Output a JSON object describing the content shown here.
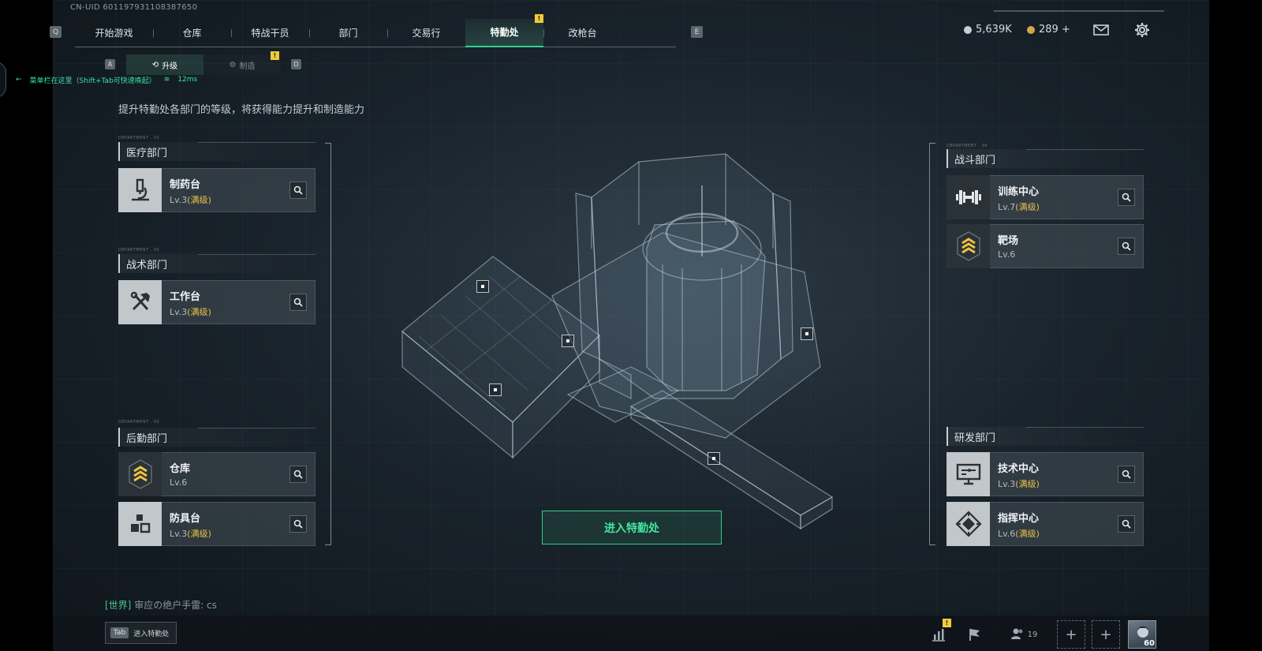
{
  "uid": "CN-UID 601197931108387650",
  "nav": {
    "key_left": "Q",
    "key_right": "E",
    "tabs": [
      "开始游戏",
      "仓库",
      "特战干员",
      "部门",
      "交易行",
      "特勤处",
      "改枪台"
    ],
    "active": "特勤处",
    "alert": "!"
  },
  "resources": {
    "silver": "5,639K",
    "gold": "289 +",
    "silver_color": "#c7cdd2",
    "gold_color": "#d4a64a",
    "mail_icon": "mail-icon",
    "settings_icon": "gear-icon"
  },
  "subnav": {
    "key_left": "A",
    "key_right": "D",
    "upgrade": "升级",
    "craft": "制造",
    "alert": "!"
  },
  "hint": {
    "text": "菜单栏在这里（Shift+Tab可快速唤起）",
    "ping": "12ms"
  },
  "description": "提升特勤处各部门的等级，将获得能力提升和制造能力",
  "departments": {
    "medical": {
      "title": "医疗部门",
      "tag": "DEPARTMENT . 01",
      "items": [
        {
          "name": "制药台",
          "level": "Lv.3",
          "max": "(满级)",
          "icon": "microscope-icon"
        }
      ]
    },
    "tactical": {
      "title": "战术部门",
      "tag": "DEPARTMENT . 02",
      "items": [
        {
          "name": "工作台",
          "level": "Lv.3",
          "max": "(满级)",
          "icon": "hammer-wrench-icon"
        }
      ]
    },
    "logistics": {
      "title": "后勤部门",
      "tag": "DEPARTMENT . 03",
      "items": [
        {
          "name": "仓库",
          "level": "Lv.6",
          "max": "",
          "icon": "rank-chevrons-icon"
        },
        {
          "name": "防具台",
          "level": "Lv.3",
          "max": "(满级)",
          "icon": "cubes-icon"
        }
      ]
    },
    "combat": {
      "title": "战斗部门",
      "tag": "DEPARTMENT . 04",
      "items": [
        {
          "name": "训练中心",
          "level": "Lv.7",
          "max": "(满级)",
          "icon": "dumbbell-icon"
        },
        {
          "name": "靶场",
          "level": "Lv.6",
          "max": "",
          "icon": "rank-chevrons-icon"
        }
      ]
    },
    "research": {
      "title": "研发部门",
      "items": [
        {
          "name": "技术中心",
          "level": "Lv.3",
          "max": "(满级)",
          "icon": "monitor-icon"
        },
        {
          "name": "指挥中心",
          "level": "Lv.6",
          "max": "(满级)",
          "icon": "emblem-icon"
        }
      ]
    }
  },
  "enter_button": "进入特勤处",
  "chat": {
    "channel": "[世界]",
    "message": "审应の绝户手雷: cs"
  },
  "tab_hint": {
    "key": "Tab",
    "label": "进入特勤处"
  },
  "bottom": {
    "friends_count": "19",
    "avatar_level": "60",
    "alert": "!"
  },
  "accent": "#2fd08d",
  "max_color": "#e6c14a"
}
